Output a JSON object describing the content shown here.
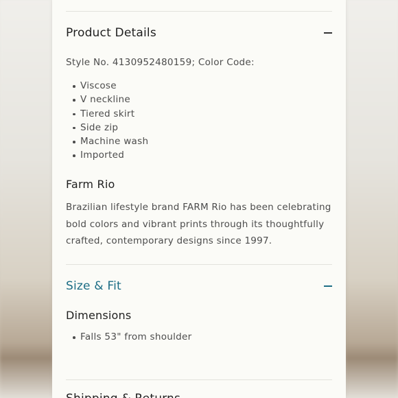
{
  "product_details": {
    "title": "Product Details",
    "style_line": "Style No. 4130952480159; Color Code:",
    "features": [
      "Viscose",
      "V neckline",
      "Tiered skirt",
      "Side zip",
      "Machine wash",
      "Imported"
    ],
    "brand_heading": "Farm Rio",
    "brand_description": "Brazilian lifestyle brand FARM Rio has been celebrating bold colors and vibrant prints through its thoughtfully crafted, contemporary designs since 1997."
  },
  "size_fit": {
    "title": "Size & Fit",
    "dimensions_heading": "Dimensions",
    "dimensions": [
      "Falls 53\" from shoulder"
    ]
  },
  "next_section": {
    "title": "Shipping & Returns"
  },
  "colors": {
    "accent": "#1c6d85",
    "panel_background": "#fbfbf7",
    "text_dark": "#1f1f1f",
    "text_body": "#4c4c4c"
  },
  "icons": [
    "minus-icon",
    "minus-icon"
  ]
}
